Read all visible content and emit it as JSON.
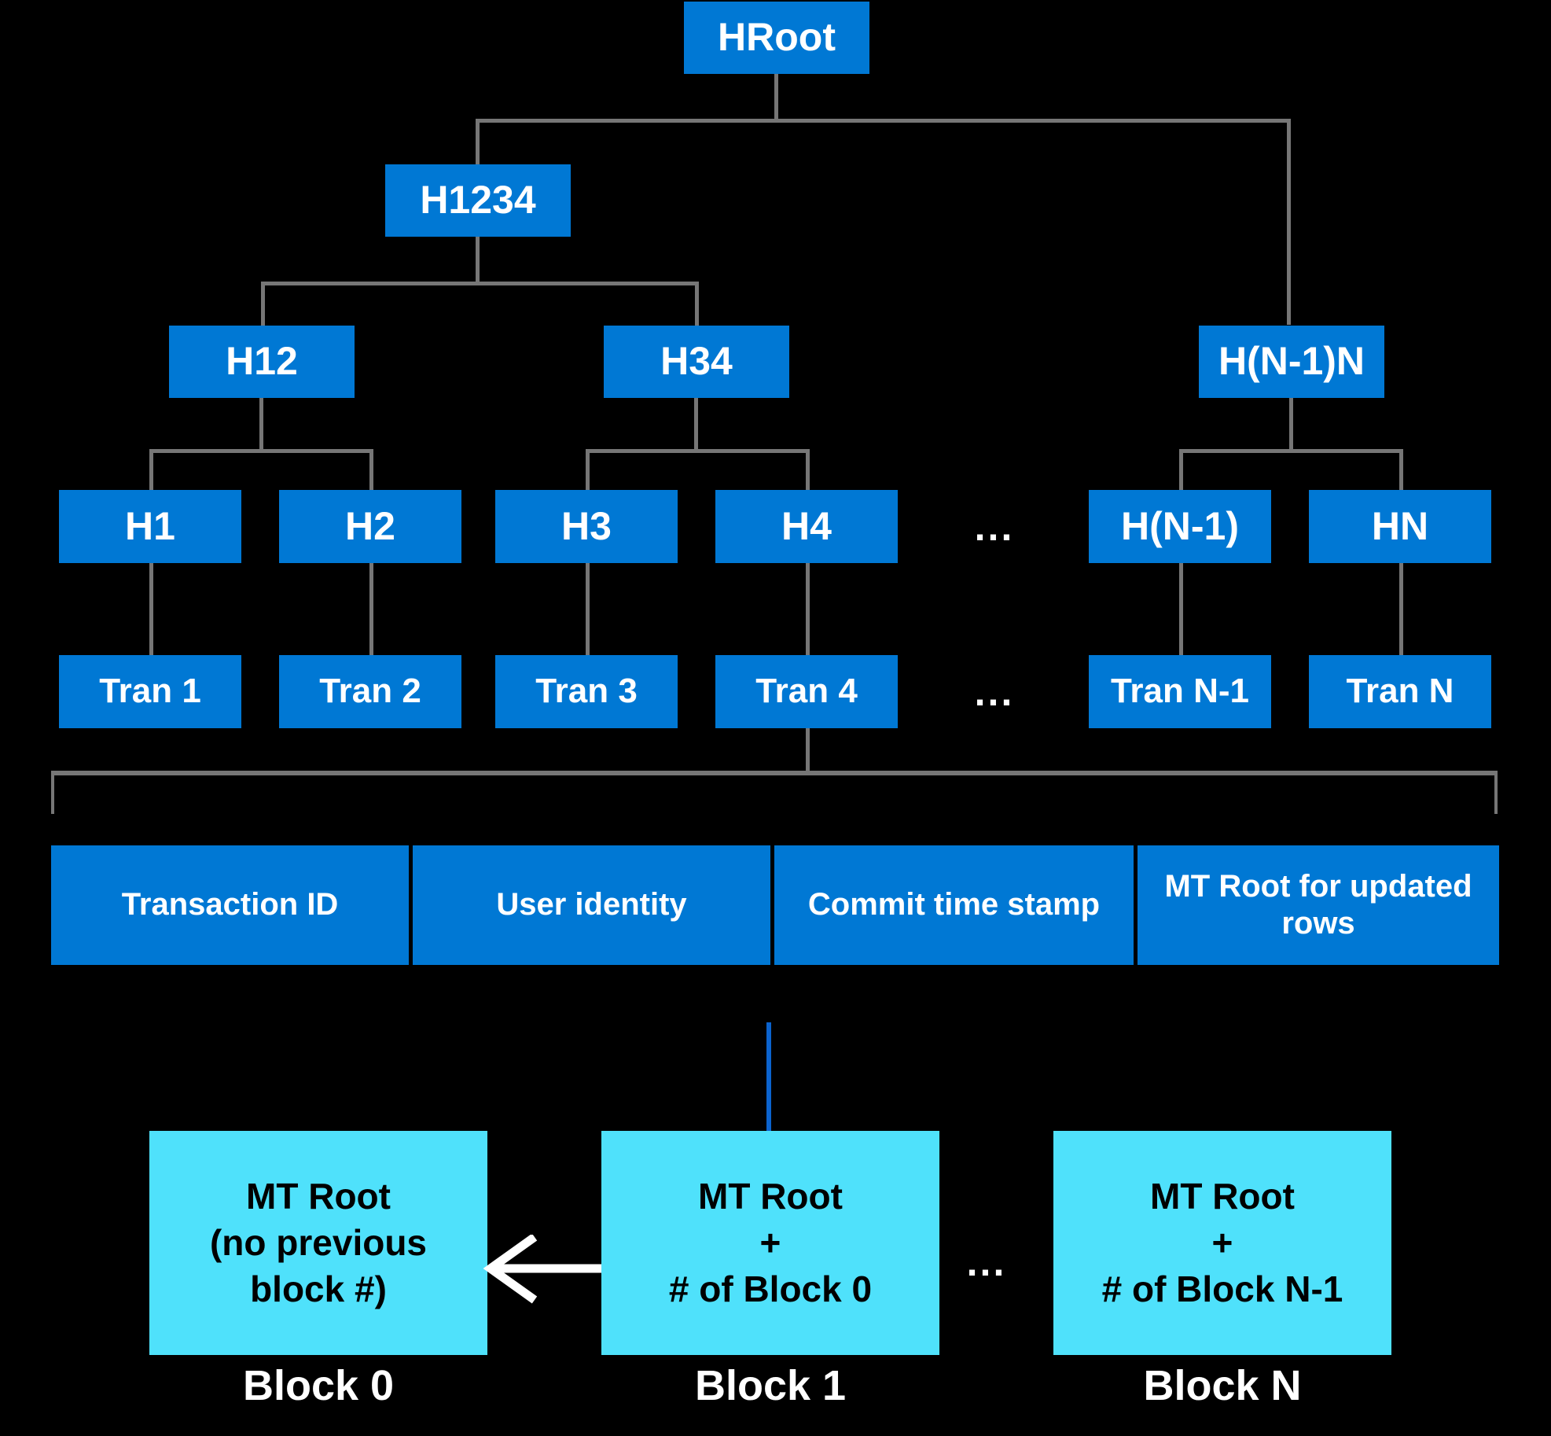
{
  "diagram": {
    "title": "Merkle tree and blockchain ledger structure",
    "colors": {
      "background": "#000000",
      "node_blue": "#0078D4",
      "block_cyan": "#4FE1FB",
      "connector_gray": "#767676",
      "arrow_white": "#FFFFFF",
      "blue_link": "#0B63CE"
    },
    "ellipsis_glyph": "..."
  },
  "merkle": {
    "root": {
      "label": "HRoot"
    },
    "level2": [
      {
        "label": "H1234"
      }
    ],
    "level3": [
      {
        "label": "H12"
      },
      {
        "label": "H34"
      },
      {
        "label": "H(N-1)N"
      }
    ],
    "level4": [
      {
        "label": "H1"
      },
      {
        "label": "H2"
      },
      {
        "label": "H3"
      },
      {
        "label": "H4"
      },
      {
        "label": "H(N-1)"
      },
      {
        "label": "HN"
      }
    ],
    "level4_ellipsis": "...",
    "transactions": [
      {
        "label": "Tran 1"
      },
      {
        "label": "Tran 2"
      },
      {
        "label": "Tran 3"
      },
      {
        "label": "Tran 4"
      },
      {
        "label": "Tran N-1"
      },
      {
        "label": "Tran N"
      }
    ],
    "transactions_ellipsis": "..."
  },
  "transaction_detail": {
    "cells": [
      {
        "label": "Transaction ID"
      },
      {
        "label": "User identity"
      },
      {
        "label": "Commit time stamp"
      },
      {
        "label": "MT Root for updated rows"
      }
    ]
  },
  "blockchain": {
    "ellipsis": "...",
    "blocks": [
      {
        "box_text": "MT Root\n(no previous\nblock #)",
        "caption": "Block 0"
      },
      {
        "box_text": "MT Root\n+\n# of Block 0",
        "caption": "Block 1"
      },
      {
        "box_text": "MT Root\n+\n# of Block N-1",
        "caption": "Block N"
      }
    ]
  }
}
